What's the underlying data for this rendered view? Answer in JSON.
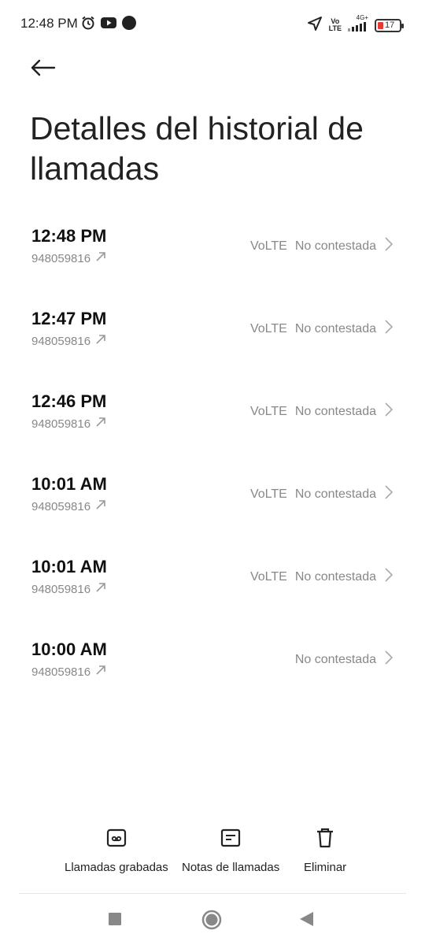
{
  "status_bar": {
    "time": "12:48 PM",
    "network_top": "Vo",
    "network_bottom": "LTE",
    "signal_type": "4G+",
    "battery": "17",
    "icons": [
      "alarm-icon",
      "youtube-icon",
      "dot-icon",
      "location-arrow-icon",
      "signal-icon",
      "battery-icon"
    ]
  },
  "header": {
    "back_icon": "arrow-left-icon",
    "title": "Detalles del historial de llamadas"
  },
  "calls": [
    {
      "time": "12:48 PM",
      "number": "948059816",
      "network": "VoLTE",
      "status": "No contestada"
    },
    {
      "time": "12:47 PM",
      "number": "948059816",
      "network": "VoLTE",
      "status": "No contestada"
    },
    {
      "time": "12:46 PM",
      "number": "948059816",
      "network": "VoLTE",
      "status": "No contestada"
    },
    {
      "time": "10:01 AM",
      "number": "948059816",
      "network": "VoLTE",
      "status": "No contestada"
    },
    {
      "time": "10:01 AM",
      "number": "948059816",
      "network": "VoLTE",
      "status": "No contestada"
    },
    {
      "time": "10:00 AM",
      "number": "948059816",
      "network": "",
      "status": "No contestada"
    }
  ],
  "actions": {
    "recorded_label": "Llamadas grabadas",
    "notes_label": "Notas de llamadas",
    "delete_label": "Eliminar"
  },
  "colors": {
    "background": "#ffffff",
    "text_primary": "#111111",
    "text_secondary": "#888888",
    "battery_low": "#e53935"
  }
}
